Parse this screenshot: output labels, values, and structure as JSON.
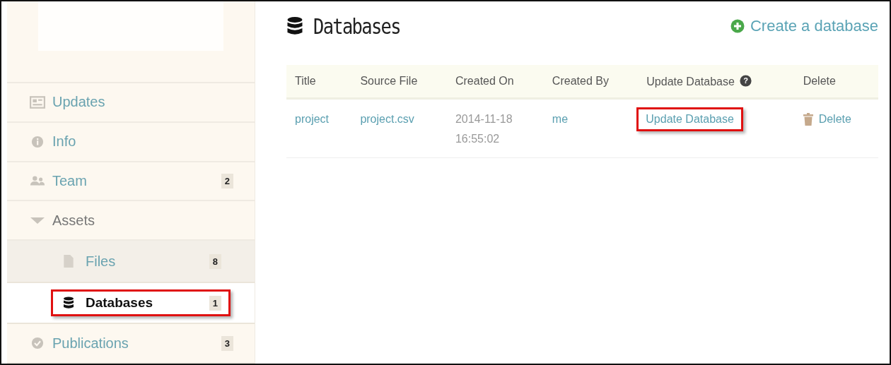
{
  "sidebar": {
    "items": [
      {
        "label": "Updates",
        "selected": false
      },
      {
        "label": "Info",
        "selected": false
      },
      {
        "label": "Team",
        "count": "2",
        "selected": false
      },
      {
        "label": "Assets",
        "selected": false,
        "expanded": true,
        "children": [
          {
            "label": "Files",
            "count": "8",
            "selected": false,
            "highlighted": false
          },
          {
            "label": "Databases",
            "count": "1",
            "selected": true,
            "highlighted": true
          }
        ]
      },
      {
        "label": "Publications",
        "count": "3",
        "selected": false
      }
    ]
  },
  "header": {
    "title": "Databases",
    "create_link": "Create a database"
  },
  "table": {
    "columns": [
      "Title",
      "Source File",
      "Created On",
      "Created By",
      "Update Database",
      "Delete"
    ],
    "help_icon": "?",
    "rows": [
      {
        "title": "project",
        "source_file": "project.csv",
        "created_on": [
          "2014-11-18",
          "16:55:02"
        ],
        "created_by": "me",
        "update": "Update Database",
        "update_highlighted": true,
        "delete": "Delete"
      }
    ]
  }
}
